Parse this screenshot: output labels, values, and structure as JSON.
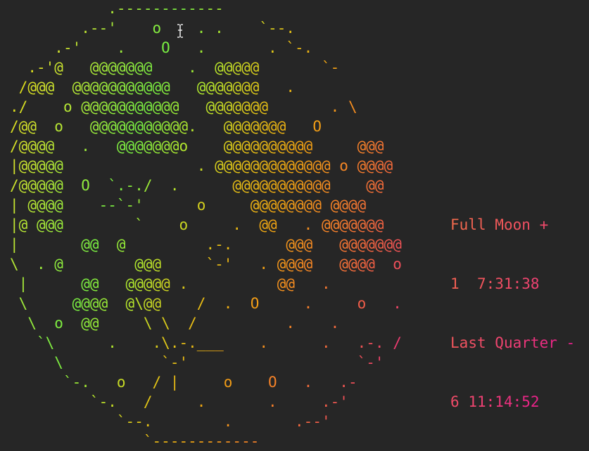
{
  "moon": {
    "rows": [
      "           .------------",
      "        .--'    o    . .    `--.",
      "     .-'    .    O   .       . `-.",
      "  .-'@   @@@@@@@    .  @@@@@       `-",
      " /@@@  @@@@@@@@@@@   @@@@@@@   .",
      "./    o @@@@@@@@@@@   @@@@@@@       . \\",
      "/@@  o   @@@@@@@@@@@.   @@@@@@@   O",
      "/@@@@   .   @@@@@@@o    @@@@@@@@@@     @@@",
      "|@@@@@               . @@@@@@@@@@@@@ o @@@@",
      "/@@@@@  O  `.-./  .      @@@@@@@@@@@    @@",
      "| @@@@    --`-'      o     @@@@@@@@ @@@@",
      "|@ @@@        `    o     .  @@   . @@@@@@@",
      "|       @@  @         .-.      @@@   @@@@@@@",
      "\\  . @        @@@     `-'   . @@@@   @@@@  o",
      " |      @@   @@@@@ .          @@   .",
      " \\     @@@@  @\\@@    /  .  O     .     o   .",
      "  \\  o  @@     \\ \\  /          .    .",
      "   `\\      .    .\\.-.___    .      .   .-. /",
      "     \\           `-'                   `-'",
      "      `-.   o   / |     o    O   .   .-",
      "         `-.   /     .       .     .-'",
      "            `--.        .       .--'",
      "               `------------"
    ],
    "colors": [
      "#ecd500",
      "#d2e02c",
      "#a2ea3b",
      "#78ee42",
      "#b6e52c",
      "#e4c316",
      "#f0a412",
      "#f58426",
      "#f26243",
      "#eb3e6e",
      "#e6199a"
    ]
  },
  "phase_info": {
    "line1_name": "Full Moon +",
    "line1_time": "1  7:31:38",
    "line2_name": "Last Quarter -",
    "line2_time": "6 11:14:52",
    "colors": [
      "#f36a4d",
      "#f0565b",
      "#ee4470",
      "#e92586",
      "#e6199a"
    ]
  },
  "cursor": {
    "icon": "text-cursor-icon",
    "color": "#e6e6e6"
  }
}
